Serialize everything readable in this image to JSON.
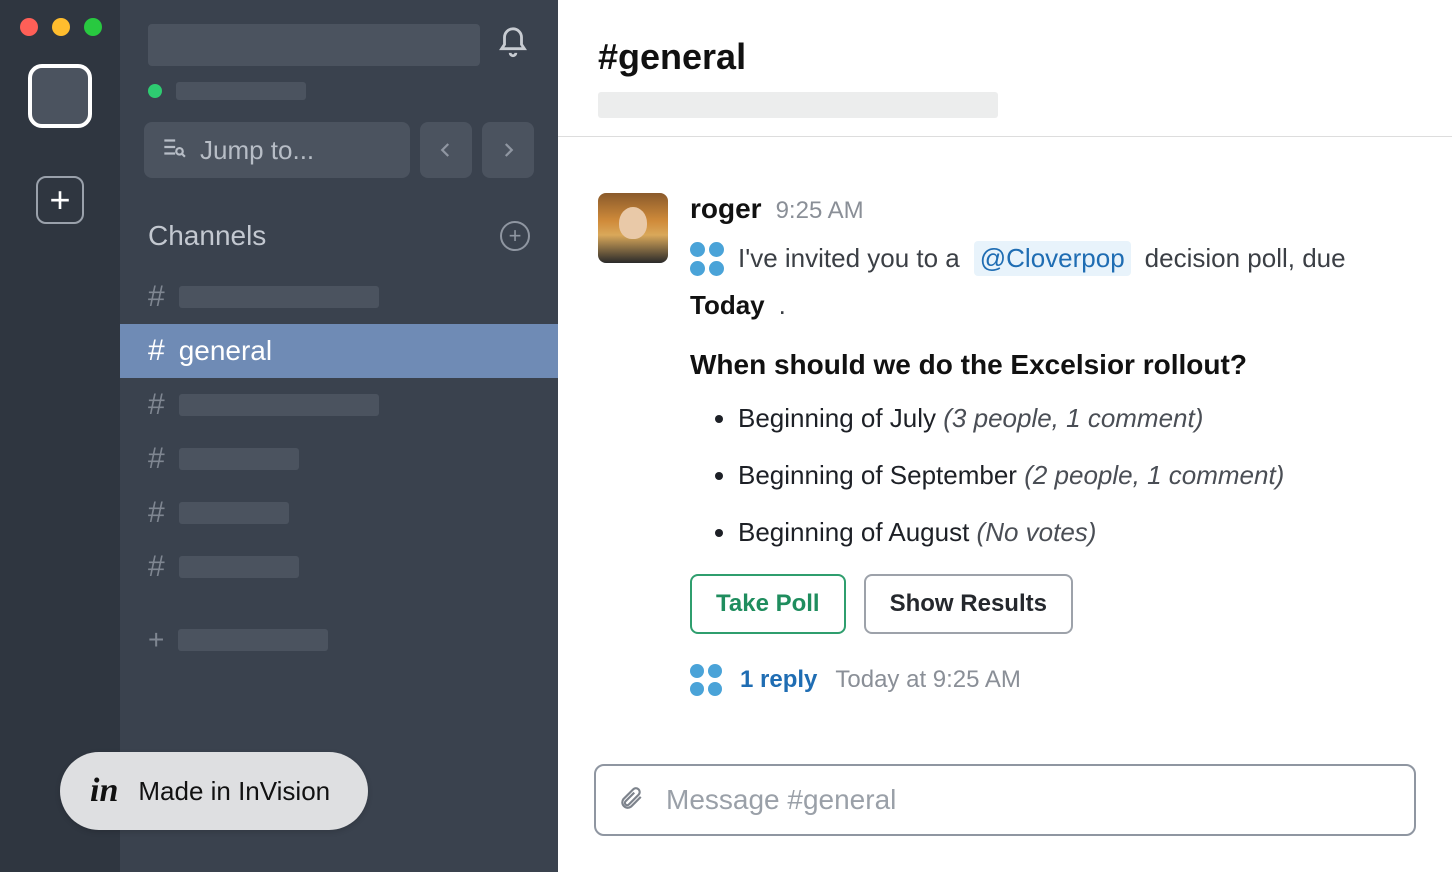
{
  "sidebar": {
    "jump_to": "Jump to...",
    "channels_label": "Channels",
    "active_channel": "general",
    "channel_symbol": "#"
  },
  "header": {
    "channel_title": "#general"
  },
  "message": {
    "author": "roger",
    "time": "9:25 AM",
    "invite_prefix": "I've invited you to a ",
    "mention": "@Cloverpop",
    "invite_middle": " decision poll, due ",
    "due": "Today",
    "invite_suffix": ".",
    "question": "When should we do the Excelsior rollout?",
    "options": [
      {
        "label": "Beginning of July",
        "meta": "(3 people, 1 comment)"
      },
      {
        "label": "Beginning of September",
        "meta": "(2 people, 1 comment)"
      },
      {
        "label": "Beginning of August",
        "meta": "(No votes)"
      }
    ],
    "take_poll": "Take Poll",
    "show_results": "Show Results",
    "reply_count": "1 reply",
    "reply_time": "Today at 9:25 AM"
  },
  "composer": {
    "placeholder": "Message #general"
  },
  "badge": {
    "logo": "in",
    "text": "Made in InVision"
  },
  "channel_placeholder_widths": [
    200,
    200,
    120,
    110,
    120
  ]
}
